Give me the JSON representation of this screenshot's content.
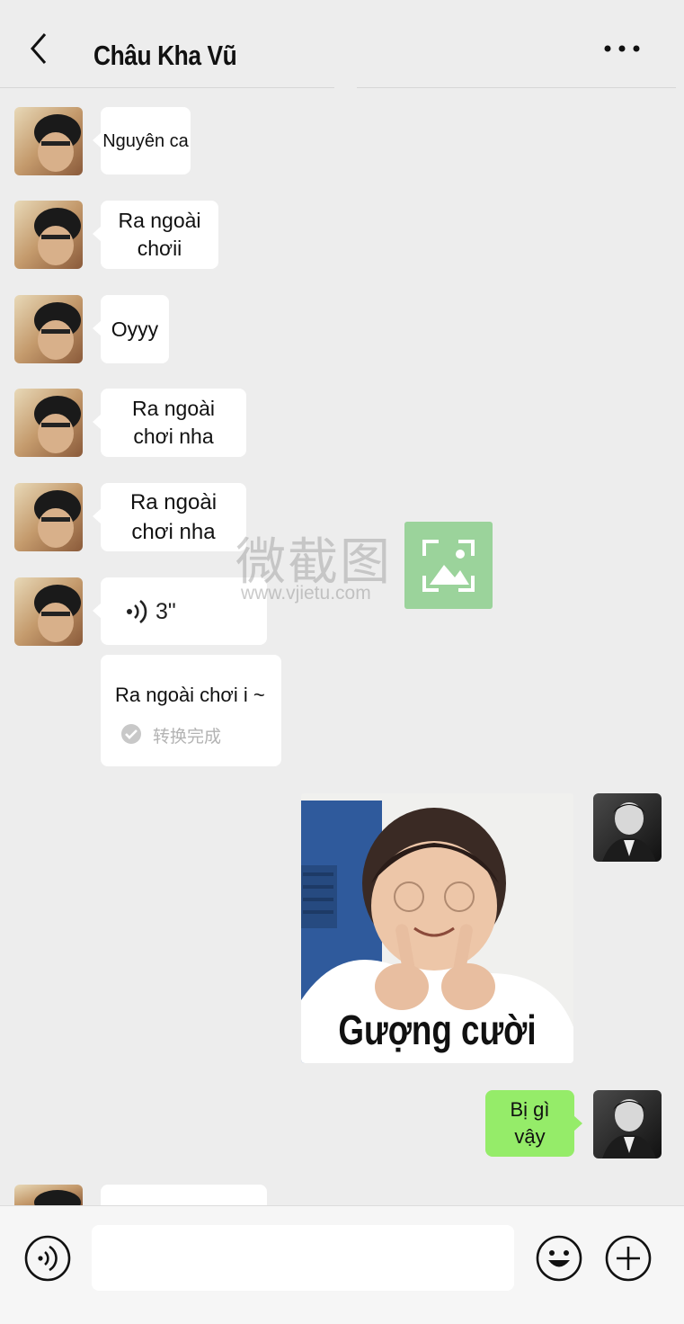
{
  "header": {
    "title": "Châu Kha Vũ"
  },
  "messages": {
    "m1": "Nguyên ca",
    "m2": "Ra ngoài chơii",
    "m3": "Oyyy",
    "m4": "Ra ngoài chơi nha",
    "m5": "Ra ngoài chơi nha",
    "voice_duration": "3\"",
    "transcript_text": "Ra ngoài chơi i ~",
    "transcript_status": "转换完成",
    "sticker_caption": "Gượng cười",
    "m_sent": "Bị gì vậy"
  },
  "watermark": {
    "cn": "微截图",
    "url": "www.vjietu.com"
  },
  "colors": {
    "background": "#ededed",
    "sent_bubble": "#95ec69",
    "received_bubble": "#ffffff"
  }
}
